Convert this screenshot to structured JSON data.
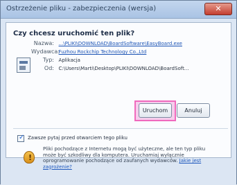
{
  "window": {
    "title": "Ostrzeżenie pliku - zabezpieczenia (wersja)",
    "close": "✕"
  },
  "dialog": {
    "heading": "Czy chcesz uruchomić ten plik?",
    "fields": [
      {
        "label": "Nazwa:",
        "value": "...\\PLIKI\\DOWNLOAD\\BoardSoftware\\EasyBoard.exe"
      },
      {
        "label": "Wydawca:",
        "value": "Fuzhou Rockchip Technology Co.,Ltd"
      },
      {
        "label": "Typ:",
        "value": "Aplikacja"
      },
      {
        "label": "Od:",
        "value": "C:\\Users\\Marti\\Desktop\\PLIKI\\DOWNLOAD\\BoardSoft..."
      }
    ],
    "buttons": {
      "run": "Uruchom",
      "cancel": "Anuluj"
    },
    "checkbox": {
      "label": "Zawsze pytaj przed otwarciem tego pliku",
      "checked": true
    },
    "warning": {
      "text": "Pliki pochodzące z Internetu mogą być użyteczne, ale ten typ pliku może być szkodliwy dla komputera. Uruchamiaj wyłącznie oprogramowanie pochodzące od zaufanych wydawców.",
      "link": "Jakie jest zagrożenie?"
    }
  }
}
